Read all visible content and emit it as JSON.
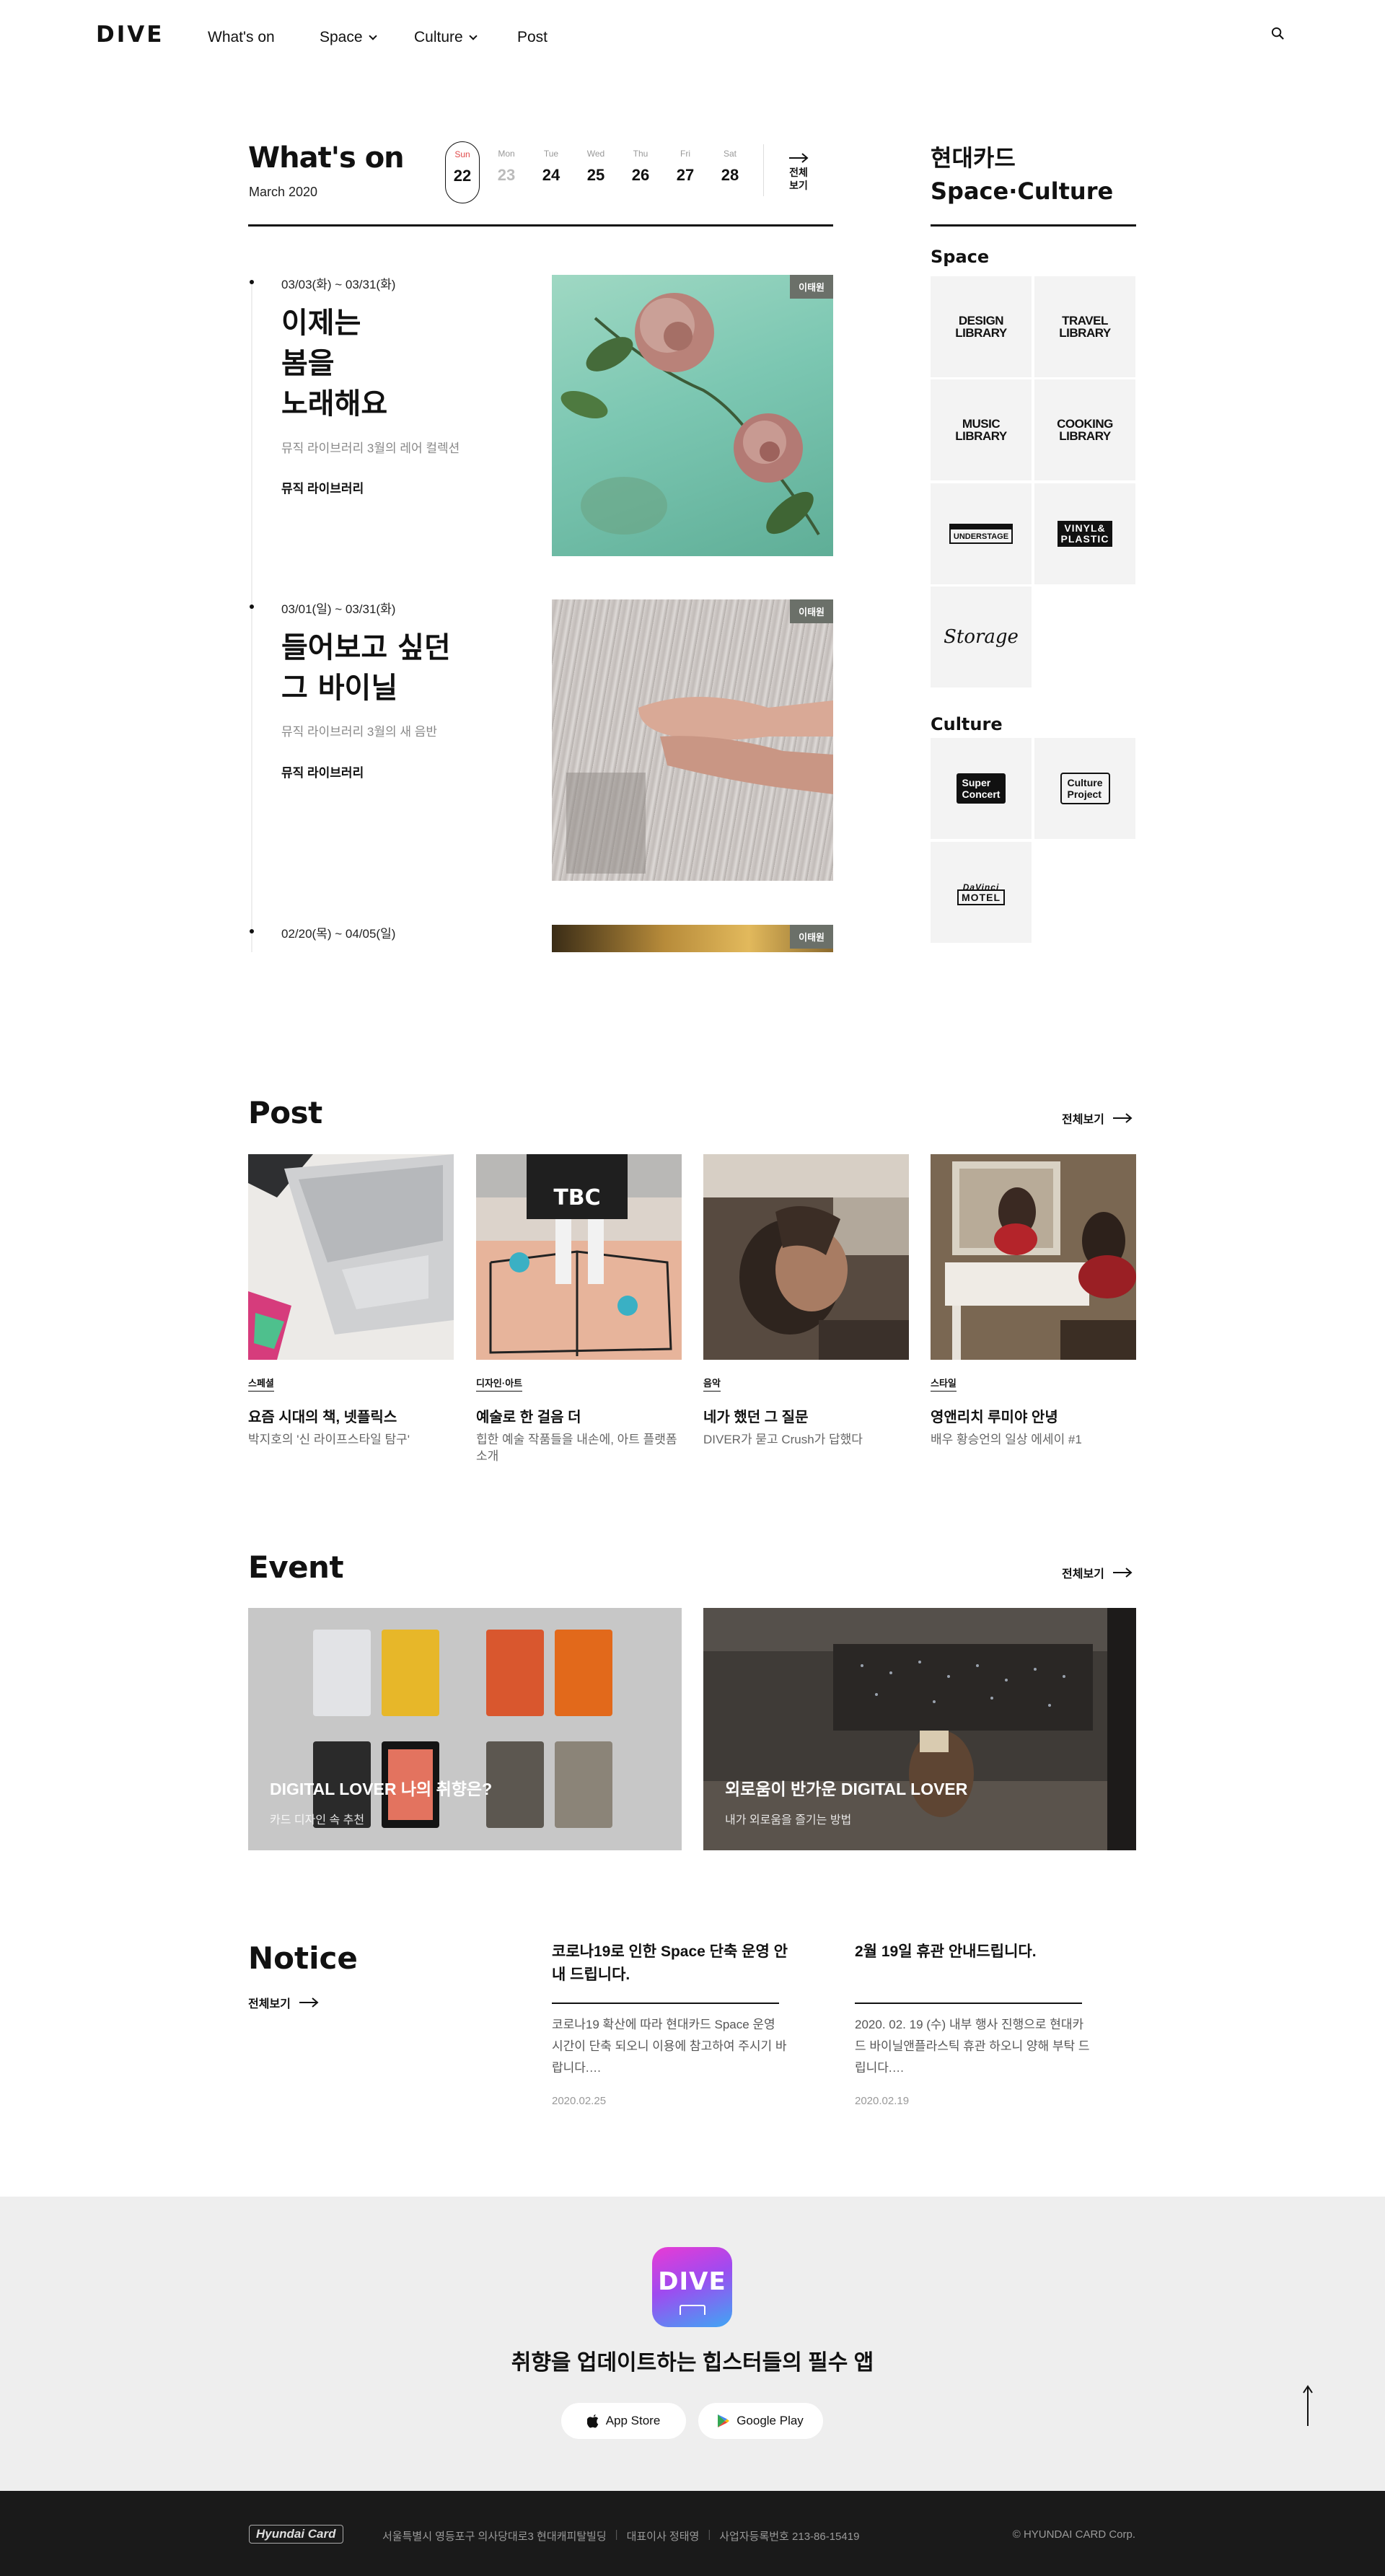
{
  "header": {
    "logo": "DIVE",
    "nav": [
      {
        "label": "What's on",
        "dropdown": false
      },
      {
        "label": "Space",
        "dropdown": true
      },
      {
        "label": "Culture",
        "dropdown": true
      },
      {
        "label": "Post",
        "dropdown": false
      }
    ],
    "search_icon": "search-icon"
  },
  "whats_on": {
    "title": "What's on",
    "month": "March 2020",
    "days": [
      {
        "name": "Sun",
        "date": "22",
        "selected": true
      },
      {
        "name": "Mon",
        "date": "23",
        "dim": true
      },
      {
        "name": "Tue",
        "date": "24"
      },
      {
        "name": "Wed",
        "date": "25"
      },
      {
        "name": "Thu",
        "date": "26"
      },
      {
        "name": "Fri",
        "date": "27"
      },
      {
        "name": "Sat",
        "date": "28"
      }
    ],
    "view_all_line1": "전체",
    "view_all_line2": "보기",
    "events": [
      {
        "date": "03/03(화) ~ 03/31(화)",
        "title_lines": [
          "이제는",
          "봄을",
          "노래해요"
        ],
        "desc": "뮤직 라이브러리 3월의 레어 컬렉션",
        "category": "뮤직 라이브러리",
        "badge": "이태원"
      },
      {
        "date": "03/01(일) ~ 03/31(화)",
        "title_lines": [
          "들어보고 싶던",
          "그 바이닐"
        ],
        "desc": "뮤직 라이브러리 3월의 새 음반",
        "category": "뮤직 라이브러리",
        "badge": "이태원"
      },
      {
        "date": "02/20(목) ~ 04/05(일)",
        "badge": "이태원"
      }
    ]
  },
  "space_culture": {
    "title_line1": "현대카드",
    "title_line2": "Space·Culture",
    "space_heading": "Space",
    "space_items": [
      {
        "line1": "DESIGN",
        "line2": "LIBRARY"
      },
      {
        "line1": "TRAVEL",
        "line2": "LIBRARY"
      },
      {
        "line1": "MUSIC",
        "line2": "LIBRARY"
      },
      {
        "line1": "COOKING",
        "line2": "LIBRARY"
      },
      {
        "line1": "UNDERSTAGE",
        "line2": ""
      },
      {
        "line1": "VINYL&",
        "line2": "PLASTIC"
      },
      {
        "line1": "Storage",
        "line2": ""
      }
    ],
    "culture_heading": "Culture",
    "culture_items": [
      {
        "line1": "Super",
        "line2": "Concert"
      },
      {
        "line1": "Culture",
        "line2": "Project"
      },
      {
        "line1": "DaVinci",
        "line2": "MOTEL"
      }
    ]
  },
  "post": {
    "title": "Post",
    "view_all": "전체보기",
    "items": [
      {
        "category": "스페셜",
        "title": "요즘 시대의 책, 넷플릭스",
        "desc": "박지호의 '신 라이프스타일 탐구'"
      },
      {
        "category": "디자인·아트",
        "title": "예술로 한 걸음 더",
        "desc": "힙한 예술 작품들을 내손에, 아트 플랫폼 소개"
      },
      {
        "category": "음악",
        "title": "네가 했던 그 질문",
        "desc": "DIVER가 묻고 Crush가 답했다"
      },
      {
        "category": "스타일",
        "title": "영앤리치 루미야 안녕",
        "desc": "배우 황승언의 일상 에세이 #1"
      }
    ]
  },
  "event": {
    "title": "Event",
    "view_all": "전체보기",
    "items": [
      {
        "title": "DIGITAL LOVER 나의 취향은?",
        "desc": "카드 디자인 속 추천"
      },
      {
        "title": "외로움이 반가운 DIGITAL LOVER",
        "desc": "내가 외로움을 즐기는 방법"
      }
    ]
  },
  "notice": {
    "title": "Notice",
    "view_all": "전체보기",
    "items": [
      {
        "title": "코로나19로 인한 Space 단축 운영 안내 드립니다.",
        "body": "코로나19 확산에 따라 현대카드 Space 운영 시간이 단축 되오니 이용에 참고하여 주시기 바랍니다.…",
        "date": "2020.02.25"
      },
      {
        "title": "2월 19일 휴관 안내드립니다.",
        "body": "2020. 02. 19 (수) 내부 행사 진행으로 현대카드 바이닐앤플라스틱 휴관 하오니 양해 부탁 드립니다.…",
        "date": "2020.02.19"
      }
    ]
  },
  "app": {
    "icon_text": "DIVE",
    "tagline": "취향을 업데이트하는 힙스터들의 필수 앱",
    "app_store": "App Store",
    "google_play": "Google Play"
  },
  "footer": {
    "brand": "Hyundai Card",
    "address": "서울특별시 영등포구 의사당대로3 현대캐피탈빌딩",
    "ceo": "대표이사 정태영",
    "biz_no": "사업자등록번호 213-86-15419",
    "copyright": "© HYUNDAI CARD Corp."
  },
  "colors": {
    "accent_red": "#e04a4a",
    "badge": "#6b7069",
    "footer_bg": "#1a1a1a",
    "band_bg": "#eeeeee"
  }
}
